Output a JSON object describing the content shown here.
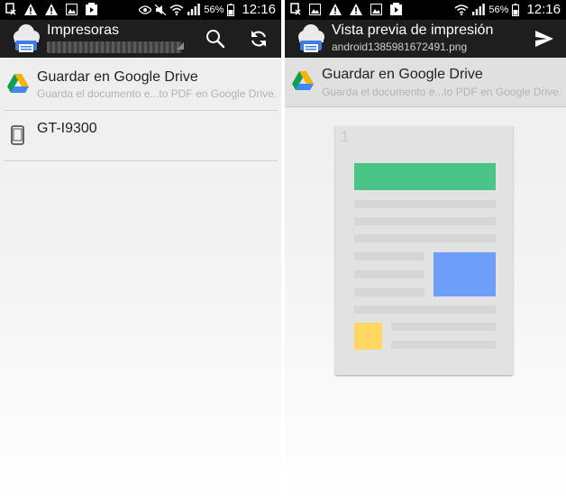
{
  "status_bar": {
    "battery_percent": "56%",
    "time": "12:16",
    "icons": [
      "blocked-call-icon",
      "warning-icon",
      "warning-icon",
      "image-icon",
      "play-store-icon",
      "eye-icon",
      "mute-icon",
      "wifi-icon",
      "signal-icon",
      "battery-icon"
    ]
  },
  "left": {
    "action_bar": {
      "title": "Impresoras",
      "subtitle_redacted": true,
      "actions": [
        "search-icon",
        "refresh-icon"
      ]
    },
    "items": [
      {
        "title": "Guardar en Google Drive",
        "subtitle": "Guarda el documento e...to PDF en Google Drive.",
        "icon": "google-drive-icon"
      },
      {
        "title": "GT-I9300",
        "subtitle": "",
        "icon": "phone-icon"
      }
    ]
  },
  "right": {
    "action_bar": {
      "title": "Vista previa de impresión",
      "subtitle": "android1385981672491.png",
      "actions": [
        "send-icon"
      ]
    },
    "selected_printer": {
      "title": "Guardar en Google Drive",
      "subtitle": "Guarda el documento e...to PDF en Google Drive.",
      "icon": "google-drive-icon"
    },
    "preview": {
      "page_number": "1"
    }
  },
  "colors": {
    "action_bar_bg": "#1e1e1e",
    "status_bar_bg": "#000000",
    "preview_green": "#4bc487",
    "preview_blue": "#6d9ef9",
    "preview_yellow": "#ffd762",
    "drive_green": "#0f9d58",
    "drive_yellow": "#f4b400",
    "drive_blue": "#4285f4"
  }
}
